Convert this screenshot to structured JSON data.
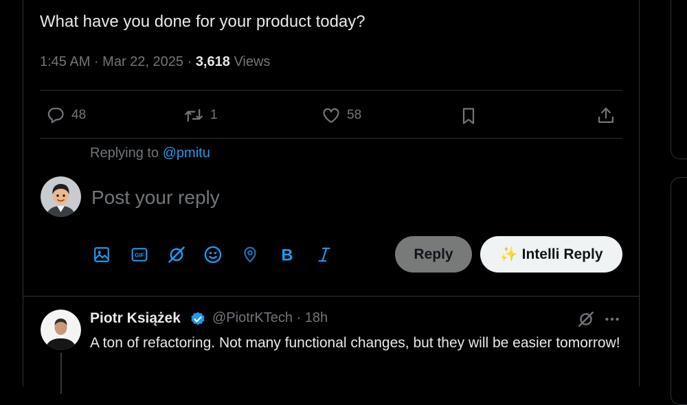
{
  "tweet": {
    "text": "What have you done for your product today?",
    "time": "1:45 AM",
    "date": "Mar 22, 2025",
    "views_count": "3,618",
    "views_label": "Views"
  },
  "actions": {
    "replies": "48",
    "retweets": "1",
    "likes": "58"
  },
  "composer": {
    "replying_prefix": "Replying to",
    "replying_handle": "@pmitu",
    "placeholder": "Post your reply",
    "reply_button": "Reply",
    "intelli_icon": "✨",
    "intelli_button": "Intelli Reply"
  },
  "reply_tweet": {
    "name": "Piotr Książek",
    "handle": "@PiotrKTech",
    "time": "18h",
    "text": "A ton of refactoring. Not many functional changes, but they will be easier tomorrow!"
  },
  "colors": {
    "accent": "#1d9bf0",
    "muted": "#71767b",
    "border": "#2f3336",
    "background": "#000000"
  }
}
